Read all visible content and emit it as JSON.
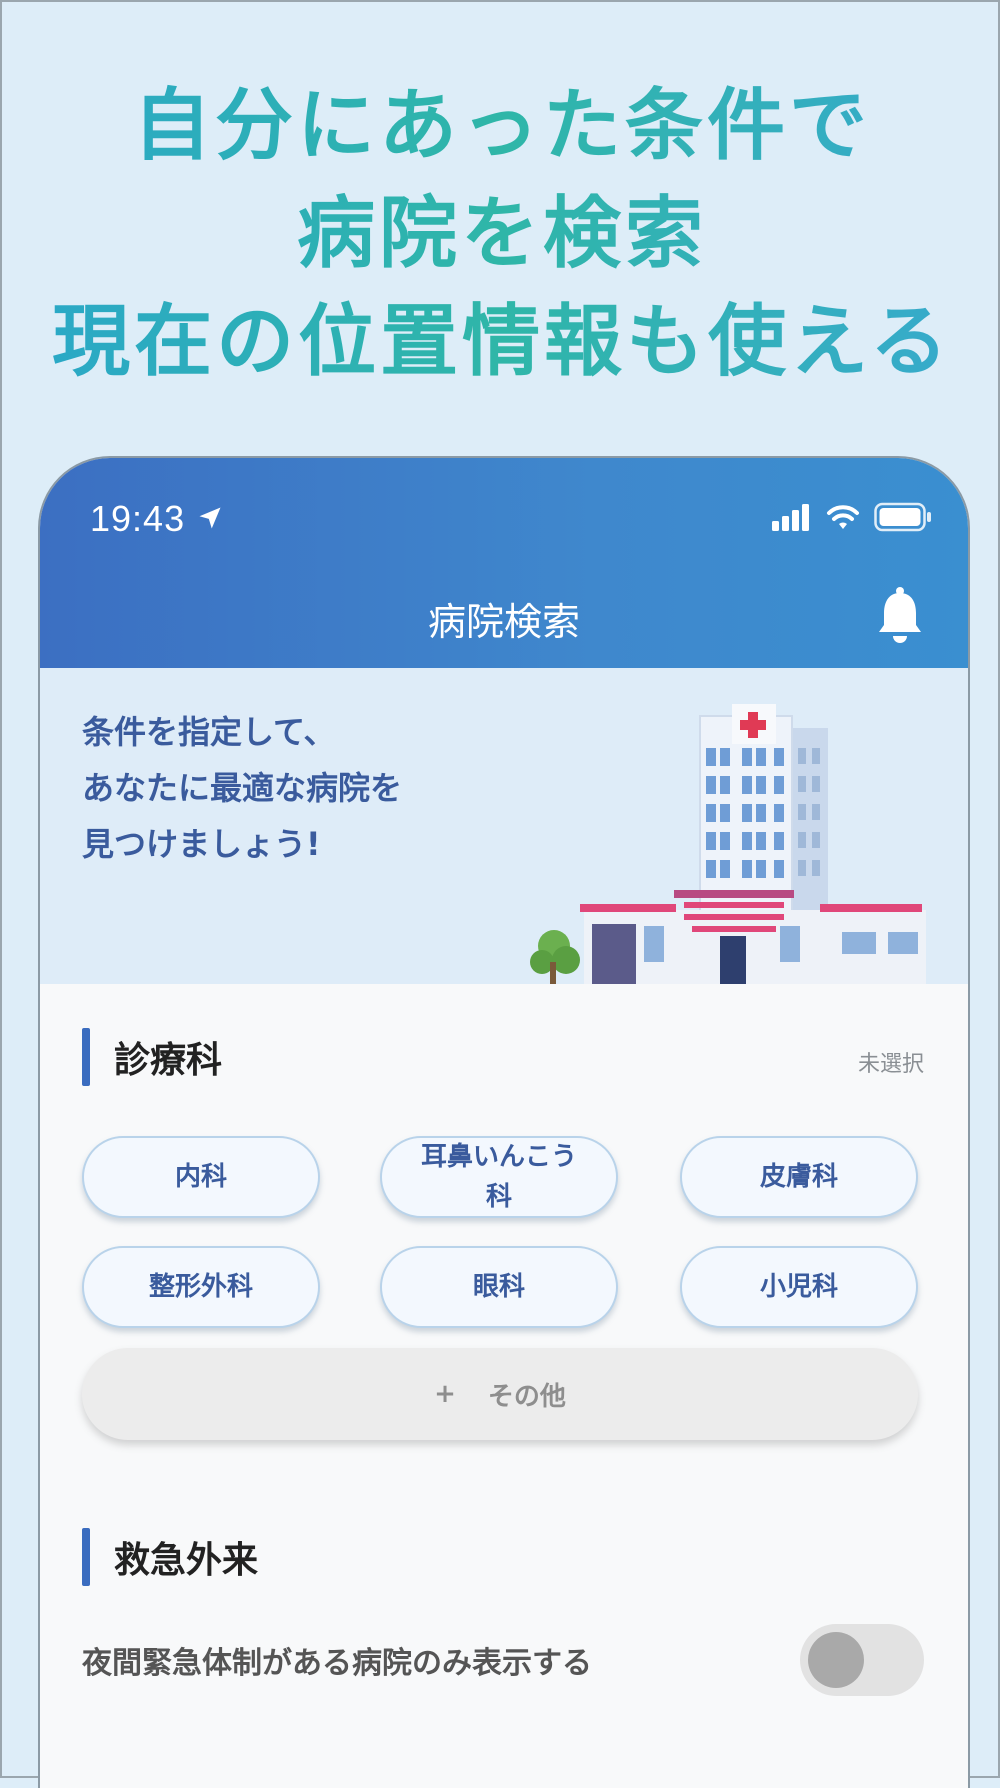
{
  "headline": {
    "line1": "自分にあった条件で",
    "line2": "病院を検索",
    "line3": "現在の位置情報も使える"
  },
  "status_bar": {
    "time": "19:43",
    "icons": [
      "location-arrow-icon",
      "signal-icon",
      "wifi-icon",
      "battery-icon"
    ]
  },
  "nav": {
    "title": "病院検索",
    "icon": "bell-icon"
  },
  "hero": {
    "text": "条件を指定して、\nあなたに最適な病院を\n見つけましょう!"
  },
  "department": {
    "title": "診療科",
    "status": "未選択",
    "chips": [
      "内科",
      "耳鼻いんこう科",
      "皮膚科",
      "整形外科",
      "眼科",
      "小児科"
    ],
    "other_plus": "+",
    "other_label": "その他"
  },
  "emergency": {
    "title": "救急外来",
    "toggle_label": "夜間緊急体制がある病院のみ表示する",
    "toggle_on": false
  },
  "colors": {
    "headline": "#2bb0a9",
    "nav_bg": "#3c7ec8",
    "accent_bar": "#3a6cbf",
    "chip_text": "#3a5b9d",
    "hero_bg": "#deecf8"
  }
}
